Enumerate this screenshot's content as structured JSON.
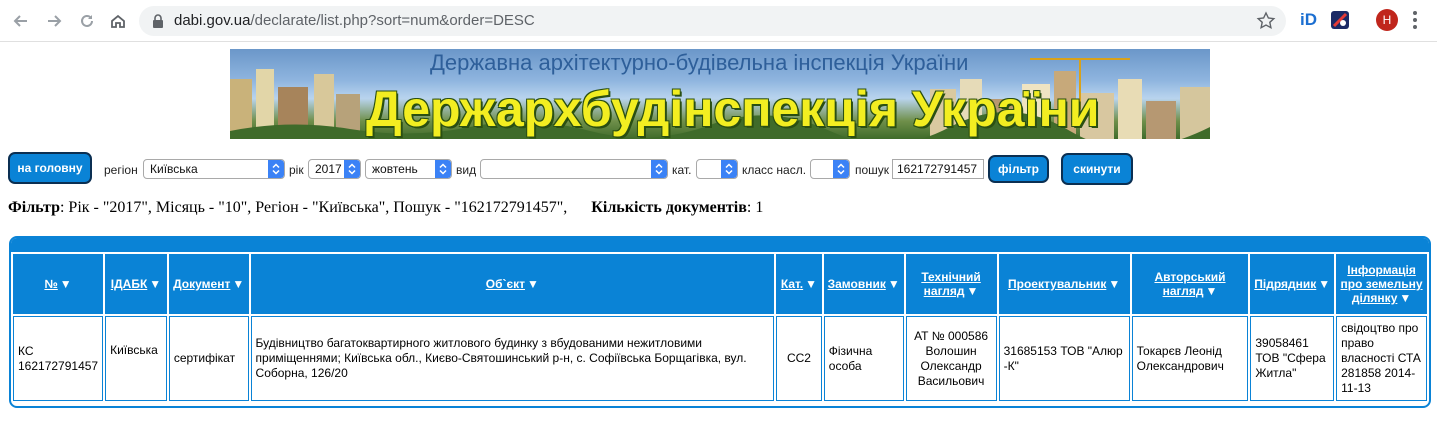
{
  "browser": {
    "url_host": "dabi.gov.ua",
    "url_path": "/declarate/list.php?sort=num&order=DESC",
    "profile_initial": "H",
    "ext_id_label": "iD"
  },
  "banner": {
    "subtitle": "Державна архітектурно-будівельна інспекція України",
    "title": "Держархбудінспекція України"
  },
  "filter_bar": {
    "home_label": "на головну",
    "region_label": "регіон",
    "region_value": "Київська",
    "year_label": "рік",
    "year_value": "2017",
    "month_value": "жовтень",
    "type_label": "вид",
    "type_value": "",
    "cat_label": "кат.",
    "cat_value": "",
    "class_label": "класс насл.",
    "class_value": "",
    "search_label": "пошук",
    "search_value": "162172791457",
    "filter_label": "фільтр",
    "reset_label": "скинути"
  },
  "summary": {
    "filter_key": "Фільтр",
    "filter_text": ": Рік - \"2017\", Місяць - \"10\", Регіон - \"Київська\", Пошук - \"162172791457\",",
    "count_key": "Кількість документів",
    "count_value": ": 1"
  },
  "table": {
    "headers": [
      "№",
      "ІДАБК",
      "Документ",
      "Об`єкт",
      "Кат.",
      "Замовник",
      "Технічний нагляд",
      "Проектувальник",
      "Авторський нагляд",
      "Підрядник",
      "Інформація про земельну ділянку"
    ],
    "sort_glyph": "▼",
    "rows": [
      [
        "КС 162172791457",
        "Київська",
        "сертифікат",
        "Будівництво багатоквартирного житлового будинку з вбудованими нежитловими приміщеннями; Київська обл., Києво-Святошинський р-н, с. Софіївська Борщагівка, вул. Соборна, 126/20",
        "СС2",
        "Фізична особа",
        "АТ № 000586 Волошин Олександр Васильович",
        "31685153 ТОВ \"Алюр -К\"",
        "Токарєв Леонід Олександрович",
        "39058461 ТОВ \"Сфера Житла\"",
        "свідоцтво про право власності СТА 281858 2014-11-13"
      ]
    ]
  },
  "colors": {
    "accent": "#0a83d6",
    "button_border": "#0b2f52",
    "banner_title": "#f3ee21"
  }
}
